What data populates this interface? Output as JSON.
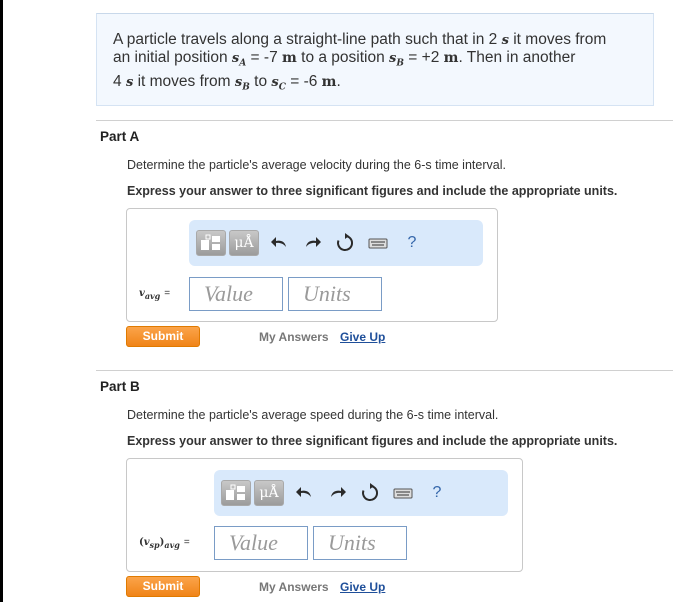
{
  "problem": {
    "line1_a": "A particle travels along a straight-line path such that in 2",
    "line1_b": "s",
    "line1_c": "it moves from",
    "line2_a": "an initial position",
    "line2_var": "s",
    "line2_sub": "A",
    "line2_b": "= -7",
    "line2_unit": "m",
    "line2_c": "to a position",
    "line2_var2": "s",
    "line2_sub2": "B",
    "line2_d": "= +2",
    "line2_unit2": "m",
    "line2_e": ". Then in another",
    "line3_a": "4",
    "line3_b": "s",
    "line3_c": "it moves from",
    "line3_var": "s",
    "line3_sub": "B",
    "line3_d": "to",
    "line3_var2": "s",
    "line3_sub2": "C",
    "line3_e": "= -6",
    "line3_unit": "m",
    "line3_f": "."
  },
  "toolbar": {
    "units_label": "μÅ",
    "help_label": "?"
  },
  "partA": {
    "title": "Part A",
    "description": "Determine the particle's average velocity during the 6-s time interval.",
    "instruction": "Express your answer to three significant figures and include the appropriate units.",
    "label_var": "v",
    "label_sub": "avg",
    "label_eq": "=",
    "value_placeholder": "Value",
    "units_placeholder": "Units",
    "submit_label": "Submit",
    "my_answers_label": "My Answers",
    "give_up_label": "Give Up"
  },
  "partB": {
    "title": "Part B",
    "description": "Determine the particle's average speed during the 6-s time interval.",
    "instruction": "Express your answer to three significant figures and include the appropriate units.",
    "label_open": "(",
    "label_var": "v",
    "label_sub1": "sp",
    "label_close": ")",
    "label_sub2": "avg",
    "label_eq": "=",
    "value_placeholder": "Value",
    "units_placeholder": "Units",
    "submit_label": "Submit",
    "my_answers_label": "My Answers",
    "give_up_label": "Give Up"
  }
}
